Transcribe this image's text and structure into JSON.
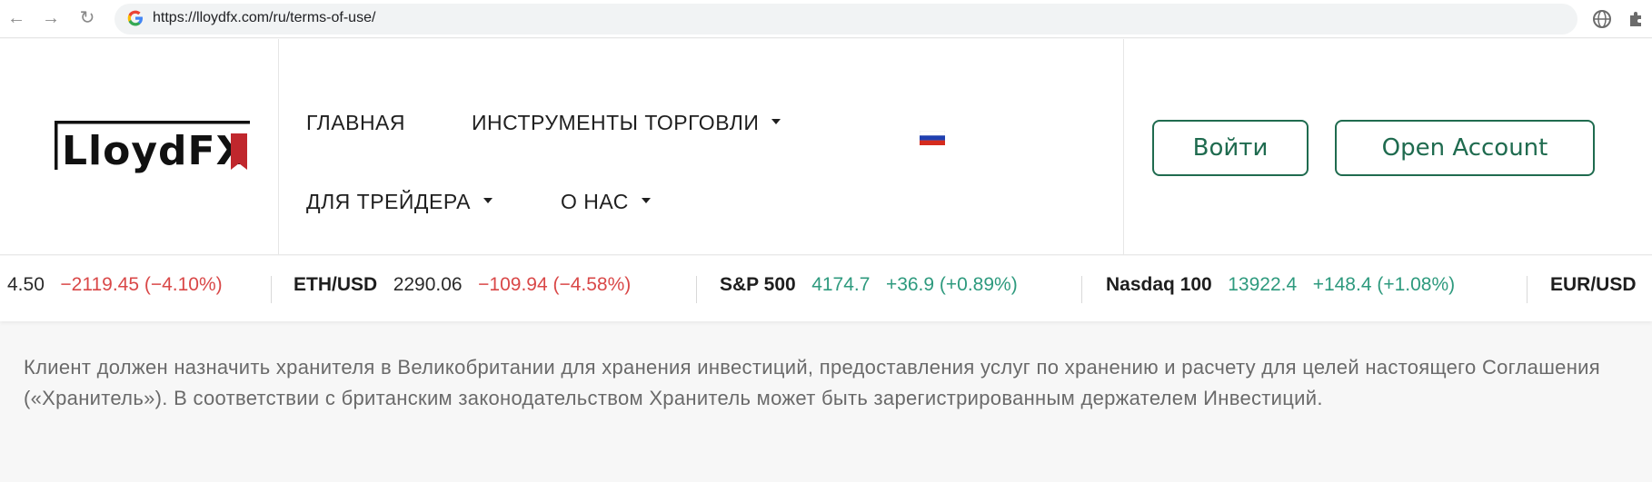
{
  "browser": {
    "url": "https://lloydfx.com/ru/terms-of-use/",
    "back_icon": "arrow-left",
    "forward_icon": "arrow-right",
    "reload_icon": "reload"
  },
  "header": {
    "logo_text": "LloydFX",
    "nav": {
      "home": "ГЛАВНАЯ",
      "instruments": "ИНСТРУМЕНТЫ ТОРГОВЛИ",
      "for_trader": "ДЛЯ ТРЕЙДЕРА",
      "about": "О НАС"
    },
    "language_flag": "ru",
    "login_label": "Войти",
    "open_account_label": "Open Account"
  },
  "ticker": [
    {
      "symbol": "",
      "price": "4.50",
      "change": "−2119.45 (−4.10%)",
      "direction": "down"
    },
    {
      "symbol": "ETH/USD",
      "price": "2290.06",
      "change": "−109.94 (−4.58%)",
      "direction": "down"
    },
    {
      "symbol": "S&P 500",
      "price": "4174.7",
      "change": "+36.9 (+0.89%)",
      "direction": "up"
    },
    {
      "symbol": "Nasdaq 100",
      "price": "13922.4",
      "change": "+148.4 (+1.08%)",
      "direction": "up"
    },
    {
      "symbol": "EUR/USD",
      "price": "",
      "change": "",
      "direction": "none"
    }
  ],
  "content": {
    "paragraph": "Клиент должен назначить хранителя в Великобритании для хранения инвестиций, предоставления услуг по хранению и расчету для целей настоящего Соглашения («Хранитель»). В соответствии с британским законодательством Хранитель может быть зарегистрированным держателем Инвестиций."
  },
  "colors": {
    "brand_green": "#1f6b4f",
    "negative": "#d94848",
    "positive": "#2e9a7e"
  }
}
